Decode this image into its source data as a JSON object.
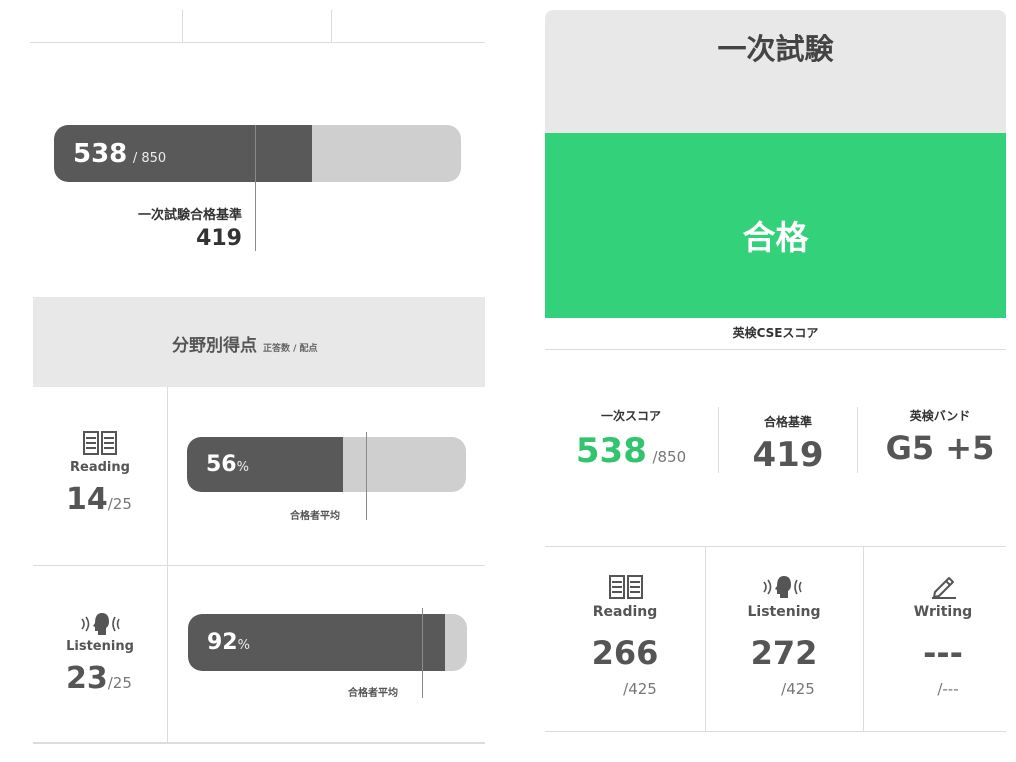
{
  "left": {
    "total": {
      "score": "538",
      "max_label": "/ 850",
      "score_ratio": 0.633,
      "pass_ratio": 0.493,
      "bench_label": "一次試験合格基準",
      "bench_value": "419"
    },
    "section": {
      "title": "分野別得点",
      "subtitle": "正答数 / 配点"
    },
    "skills": [
      {
        "label": "Reading",
        "icon": "book-icon",
        "score": "14",
        "max": "/25",
        "percent_value": "56",
        "percent_sign": "%",
        "ratio": 0.56,
        "avg_ratio": 0.64,
        "avg_label": "合格者平均"
      },
      {
        "label": "Listening",
        "icon": "listening-head-icon",
        "score": "23",
        "max": "/25",
        "percent_value": "92",
        "percent_sign": "%",
        "ratio": 0.92,
        "avg_ratio": 0.84,
        "avg_label": "合格者平均"
      }
    ]
  },
  "right": {
    "header_title": "一次試験",
    "result": "合格",
    "cse_label": "英検CSEスコア",
    "summary": [
      {
        "label": "一次スコア",
        "value": "538",
        "max": "/850",
        "color": "#33c46e"
      },
      {
        "label": "合格基準",
        "value": "419",
        "color": "#555555"
      },
      {
        "label": "英検バンド",
        "value": "G5 +5",
        "color": "#555555"
      }
    ],
    "skills": [
      {
        "label": "Reading",
        "icon": "book-icon",
        "value": "266",
        "max": "/425"
      },
      {
        "label": "Listening",
        "icon": "listening-head-icon",
        "value": "272",
        "max": "/425"
      },
      {
        "label": "Writing",
        "icon": "pencil-icon",
        "value": "---",
        "max": "/---"
      }
    ]
  },
  "colors": {
    "pass_green": "#33d17a",
    "bar_fill": "#595959",
    "bar_track": "#cfcfcf",
    "header_gray": "#e8e8e8"
  }
}
